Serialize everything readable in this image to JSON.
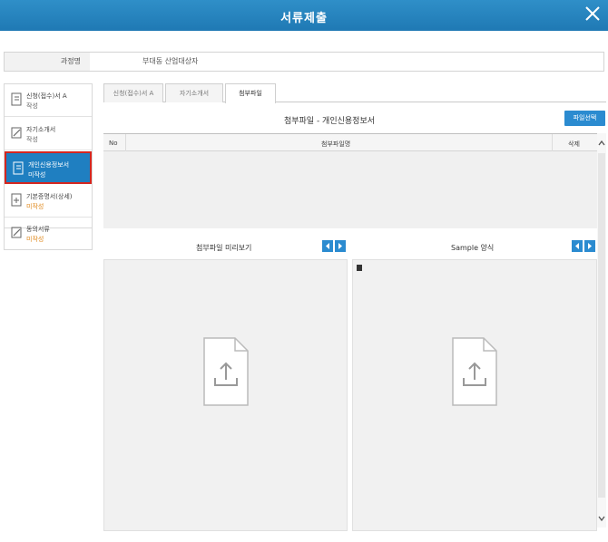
{
  "window": {
    "title": "서류제출",
    "close_icon": "close-x-icon"
  },
  "course": {
    "label": "과정명",
    "value": "부대동 산업대상자"
  },
  "sidebar": {
    "items": [
      {
        "line1": "신청(접수)서 A",
        "line2": "작성",
        "icon": "document-icon",
        "status": "normal"
      },
      {
        "line1": "자기소개서",
        "line2": "작성",
        "icon": "edit-icon",
        "status": "normal"
      },
      {
        "line1": "개인신용정보서",
        "line2": "미작성",
        "icon": "document-icon",
        "status": "active"
      },
      {
        "line1": "기본증명서(상세)",
        "line2": "미작성",
        "icon": "plus-doc-icon",
        "status": "warn"
      },
      {
        "line1": "동의서류",
        "line2": "미작성",
        "icon": "edit-icon",
        "status": "warn"
      }
    ]
  },
  "tabs": [
    {
      "label": "신청(접수)서 A",
      "active": false
    },
    {
      "label": "자기소개서",
      "active": false
    },
    {
      "label": "첨부파일",
      "active": true
    }
  ],
  "attachments": {
    "title": "첨부파일 - 개인신용정보서",
    "select_button": "파일선택",
    "columns": {
      "no": "No",
      "filename": "첨부파일명",
      "delete": "삭제"
    }
  },
  "preview": {
    "left_title": "첨부파일 미리보기",
    "right_title": "Sample 양식",
    "upload_icon": "file-upload-icon"
  },
  "colors": {
    "titlebar": "#1f79b4",
    "active_item": "#1f7fc1",
    "active_border": "#d4261f",
    "button": "#2b8bd0",
    "warn_text": "#e08a1e"
  }
}
